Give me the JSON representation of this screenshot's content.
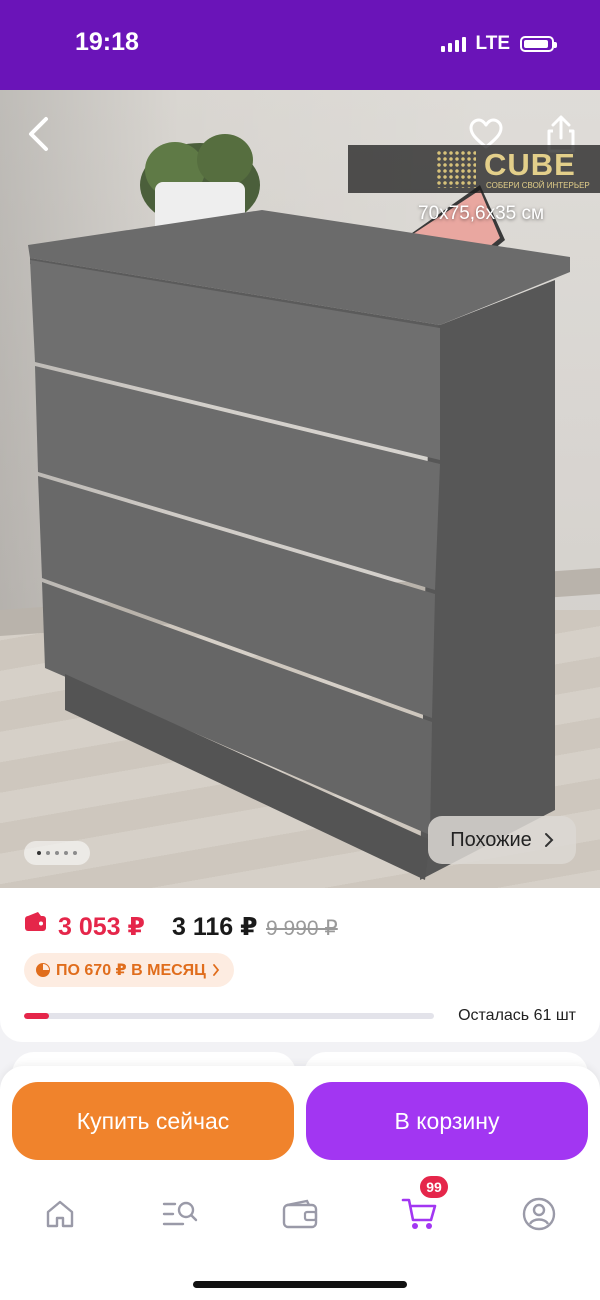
{
  "status_bar": {
    "time": "19:18",
    "network": "LTE"
  },
  "product_image": {
    "brand": {
      "name": "CUBE",
      "tagline": "СОБЕРИ СВОЙ ИНТЕРЬЕР"
    },
    "dimensions": "70x75,6x35 см",
    "page_indicator": {
      "count": 5,
      "active_index": 0
    },
    "similar_button": {
      "label": "Похожие",
      "icon": "chevron-right-icon"
    },
    "icons": [
      "back-icon",
      "heart-icon",
      "share-icon"
    ]
  },
  "pricing": {
    "wallet_price": "3 053 ₽",
    "price": "3 116 ₽",
    "old_price": "9 990 ₽",
    "installment": "ПО 670 ₽ В МЕСЯЦ",
    "stock_label": "Осталась 61 шт",
    "stock_fraction": 0.06
  },
  "actions": {
    "buy_now": "Купить сейчас",
    "add_to_cart": "В корзину"
  },
  "tabbar": {
    "items": [
      "home-icon",
      "catalog-search-icon",
      "wallet-icon",
      "cart-icon",
      "profile-icon"
    ],
    "cart_badge": "99"
  },
  "colors": {
    "brand_purple": "#6a14b8",
    "price_red": "#e5264a",
    "buy_orange": "#f0832c",
    "cart_purple": "#a236f2",
    "installment_orange": "#e06d1c"
  }
}
